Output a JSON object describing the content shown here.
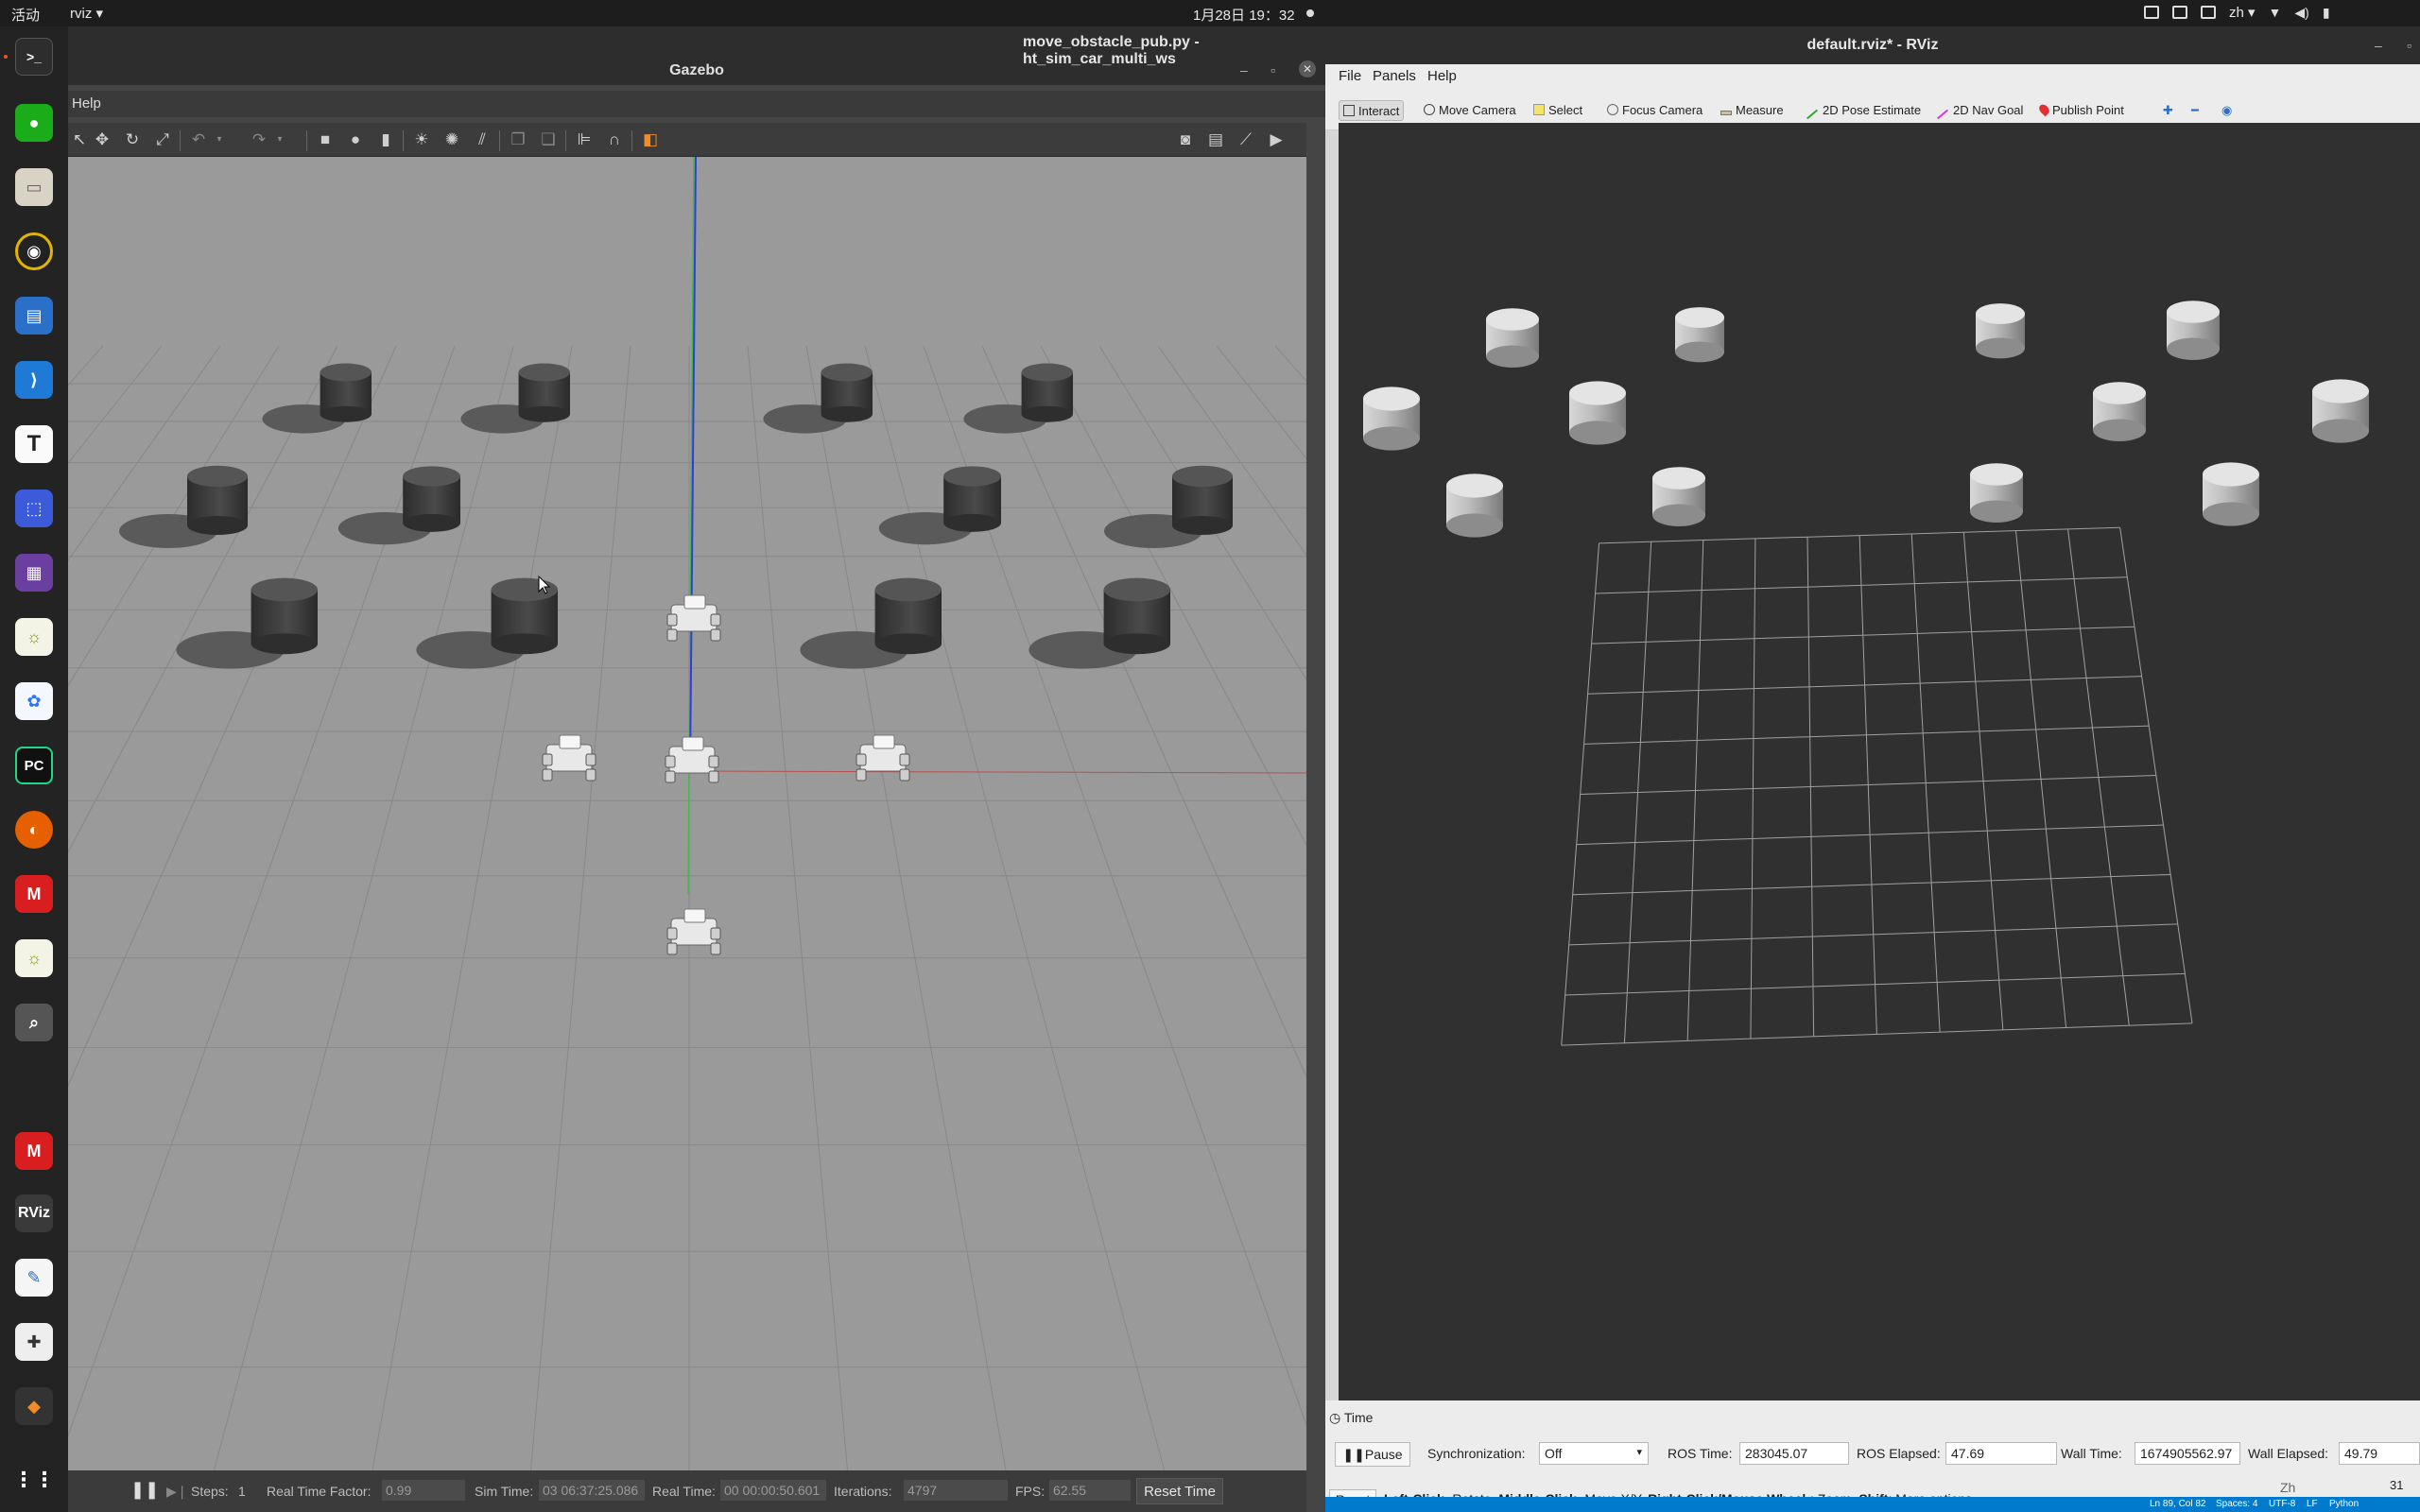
{
  "topbar": {
    "activities": "活动",
    "app_menu": "rviz ▾",
    "clock": "1月28日 19：32",
    "lang": "zh ▾"
  },
  "gazebo": {
    "vscode_title": "move_obstacle_pub.py - ht_sim_car_multi_ws",
    "title": "Gazebo",
    "menu_help": "Help",
    "bottom": {
      "steps_label": "Steps:",
      "steps_value": "1",
      "rtf_label": "Real Time Factor:",
      "rtf_value": "0.99",
      "sim_time_label": "Sim Time:",
      "sim_time_value": "03 06:37:25.086",
      "real_time_label": "Real Time:",
      "real_time_value": "00 00:00:50.601",
      "iterations_label": "Iterations:",
      "iterations_value": "4797",
      "fps_label": "FPS:",
      "fps_value": "62.55",
      "reset_time": "Reset Time"
    }
  },
  "rviz": {
    "title": "default.rviz* - RViz",
    "menu": [
      "File",
      "Panels",
      "Help"
    ],
    "tools": [
      "Interact",
      "Move Camera",
      "Select",
      "Focus Camera",
      "Measure",
      "2D Pose Estimate",
      "2D Nav Goal",
      "Publish Point"
    ],
    "time_panel": {
      "header": "Time",
      "pause": "Pause",
      "sync_label": "Synchronization:",
      "sync_value": "Off",
      "ros_time_label": "ROS Time:",
      "ros_time_value": "283045.07",
      "ros_elapsed_label": "ROS Elapsed:",
      "ros_elapsed_value": "47.69",
      "wall_time_label": "Wall Time:",
      "wall_time_value": "1674905562.97",
      "wall_elapsed_label": "Wall Elapsed:",
      "wall_elapsed_value": "49.79"
    },
    "reset": "Reset",
    "hint": {
      "left_click": "Left-Click:",
      "left_click_text": " Rotate. ",
      "middle_click": "Middle-Click:",
      "middle_click_text": " Move X/Y. ",
      "right_click": "Right-Click/Mouse Wheel:",
      "right_click_text": ": Zoom. ",
      "shift": "Shift",
      "shift_text": ": More options."
    },
    "ime": "Zh",
    "clock_fragment": "31",
    "statusbar": [
      "Ln 89, Col 82",
      "Spaces: 4",
      "UTF-8",
      "LF",
      "Python"
    ]
  },
  "dock": {
    "items": [
      "terminal-icon",
      "wechat-icon",
      "files-icon",
      "rhythmbox-icon",
      "writer-icon",
      "vscode-icon",
      "typora-icon",
      "screenshot-icon",
      "video-icon",
      "brightness-icon",
      "baidunetdisk-icon",
      "pycharm-icon",
      "firefox-icon",
      "mindmaster-icon",
      "brightness-icon",
      "magnifier-icon",
      "mindmaster-icon",
      "rviz-icon",
      "text-editor-icon",
      "gamepad-icon",
      "layers-icon",
      "app-grid-icon"
    ]
  },
  "colors": {
    "ubuntu_orange": "#e95420",
    "rviz_bg": "#303030",
    "gazebo_ground": "#9a9a9a",
    "vscode_blue": "#007acc"
  }
}
